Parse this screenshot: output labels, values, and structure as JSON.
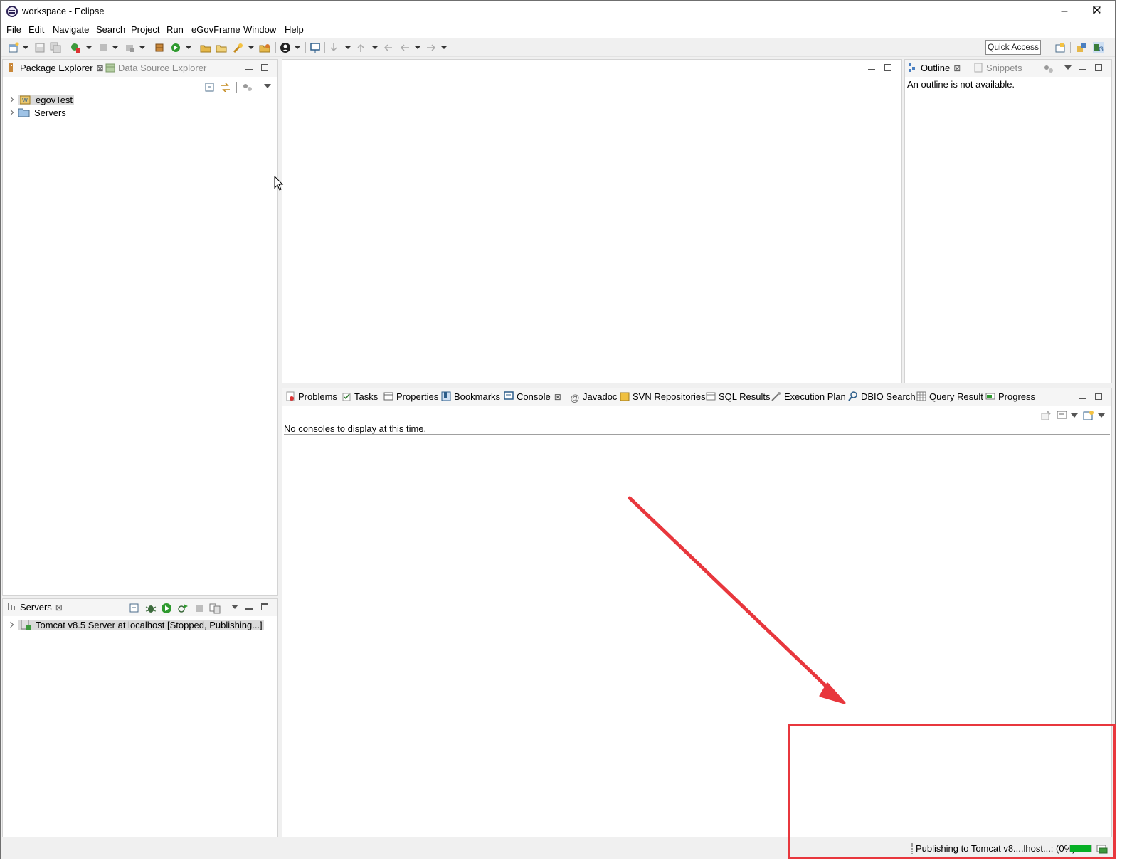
{
  "window": {
    "title": "workspace - Eclipse",
    "controls": {
      "minimize": "–",
      "maximize": "☐",
      "close": "✕"
    }
  },
  "menu": [
    "File",
    "Edit",
    "Navigate",
    "Search",
    "Project",
    "Run",
    "eGovFrame",
    "Window",
    "Help"
  ],
  "toolbar": {
    "quick_access": "Quick Access"
  },
  "package_explorer": {
    "tabs": [
      {
        "label": "Package Explorer",
        "icon": "package-icon",
        "active": true
      },
      {
        "label": "Data Source Explorer",
        "icon": "database-icon",
        "active": false
      }
    ],
    "tree": [
      {
        "label": "egovTest",
        "icon": "project-icon",
        "selected": true
      },
      {
        "label": "Servers",
        "icon": "folder-icon",
        "selected": false
      }
    ]
  },
  "outline": {
    "tabs": [
      {
        "label": "Outline",
        "icon": "outline-icon",
        "active": true
      },
      {
        "label": "Snippets",
        "icon": "snippets-icon",
        "active": false
      }
    ],
    "message": "An outline is not available."
  },
  "servers": {
    "tab": "Servers",
    "items": [
      {
        "label": "Tomcat v8.5 Server at localhost  [Stopped, Publishing...]",
        "icon": "tomcat-server-icon",
        "selected": true
      }
    ]
  },
  "console_area": {
    "tabs": [
      {
        "label": "Problems",
        "icon": "problems-icon"
      },
      {
        "label": "Tasks",
        "icon": "tasks-icon"
      },
      {
        "label": "Properties",
        "icon": "properties-icon"
      },
      {
        "label": "Bookmarks",
        "icon": "bookmarks-icon"
      },
      {
        "label": "Console",
        "icon": "console-icon",
        "active": true
      },
      {
        "label": "Javadoc",
        "icon": "javadoc-icon"
      },
      {
        "label": "SVN Repositories",
        "icon": "svn-icon"
      },
      {
        "label": "SQL Results",
        "icon": "sql-results-icon"
      },
      {
        "label": "Execution Plan",
        "icon": "execution-plan-icon"
      },
      {
        "label": "DBIO Search",
        "icon": "dbio-search-icon"
      },
      {
        "label": "Query Result",
        "icon": "query-result-icon"
      },
      {
        "label": "Progress",
        "icon": "progress-icon"
      }
    ],
    "message": "No consoles to display at this time."
  },
  "status": {
    "text": "Publishing to Tomcat v8....lhost...: (0%)",
    "progress": 1.0
  },
  "colors": {
    "annotation": "#e8373d",
    "progress": "#06b025",
    "selection": "#dadada"
  }
}
